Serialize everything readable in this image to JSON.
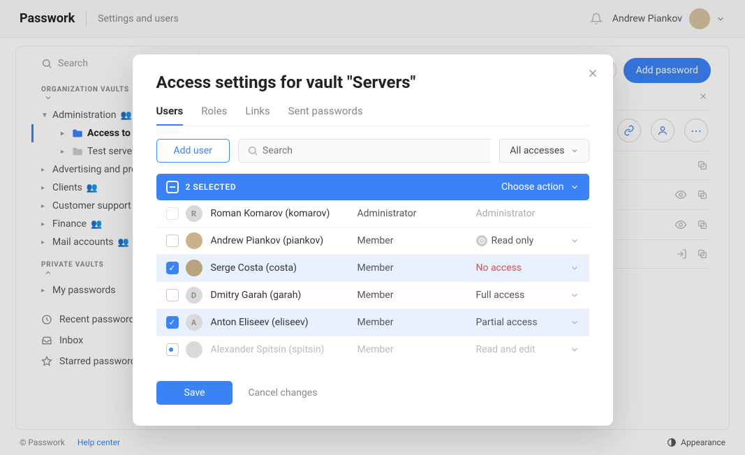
{
  "header": {
    "logo": "Passwork",
    "breadcrumb": "Settings and users",
    "user_name": "Andrew Piankov"
  },
  "sidebar": {
    "search_placeholder": "Search",
    "org_section": "ORGANIZATION VAULTS",
    "private_section": "PRIVATE VAULTS",
    "tree": {
      "administration": "Administration",
      "access_to_servers": "Access to servers",
      "test_servers": "Test servers",
      "advertising": "Advertising and promotion",
      "clients": "Clients",
      "customer_support": "Customer support",
      "finance": "Finance",
      "mail_accounts": "Mail accounts",
      "my_passwords": "My passwords"
    },
    "recent": "Recent passwords",
    "inbox": "Inbox",
    "starred": "Starred passwords"
  },
  "content": {
    "add_password": "Add password"
  },
  "modal": {
    "title": "Access settings for vault \"Servers\"",
    "tabs": {
      "users": "Users",
      "roles": "Roles",
      "links": "Links",
      "sent": "Sent passwords"
    },
    "add_user": "Add user",
    "search_placeholder": "Search",
    "filter": "All accesses",
    "selected_label": "2 SELECTED",
    "choose_action": "Choose action",
    "users": [
      {
        "name": "Roman Komarov (komarov)",
        "role": "Administrator",
        "access": "Administrator",
        "access_kind": "admin",
        "initial": "R",
        "avatar_bg": "#d9d9d9",
        "avatar_fg": "#888",
        "checked": false,
        "disabled": true
      },
      {
        "name": "Andrew Piankov (piankov)",
        "role": "Member",
        "access": "Read only",
        "access_kind": "normal",
        "initial": "",
        "avatar_bg": "#cbb28a",
        "avatar_fg": "#6b5a3e",
        "checked": false,
        "disabled": false,
        "clock": true
      },
      {
        "name": "Serge Costa (costa)",
        "role": "Member",
        "access": "No access",
        "access_kind": "noaccess",
        "initial": "",
        "avatar_bg": "#b8a37f",
        "avatar_fg": "#5c4a2e",
        "checked": true,
        "disabled": false
      },
      {
        "name": "Dmitry Garah (garah)",
        "role": "Member",
        "access": "Full access",
        "access_kind": "normal",
        "initial": "D",
        "avatar_bg": "#d9d9d9",
        "avatar_fg": "#888",
        "checked": false,
        "disabled": false
      },
      {
        "name": "Anton Eliseev (eliseev)",
        "role": "Member",
        "access": "Partial access",
        "access_kind": "normal",
        "initial": "A",
        "avatar_bg": "#d9d9d9",
        "avatar_fg": "#888",
        "checked": true,
        "disabled": false
      },
      {
        "name": "Alexander Spitsin (spitsin)",
        "role": "Member",
        "access": "Read and edit",
        "access_kind": "dim",
        "initial": "",
        "avatar_bg": "#d9d9d9",
        "avatar_fg": "#aaa",
        "checked": false,
        "disabled": false,
        "pending": true
      }
    ],
    "save": "Save",
    "cancel": "Cancel changes"
  },
  "footer": {
    "copyright": "© Passwork",
    "help": "Help center",
    "appearance": "Appearance"
  }
}
